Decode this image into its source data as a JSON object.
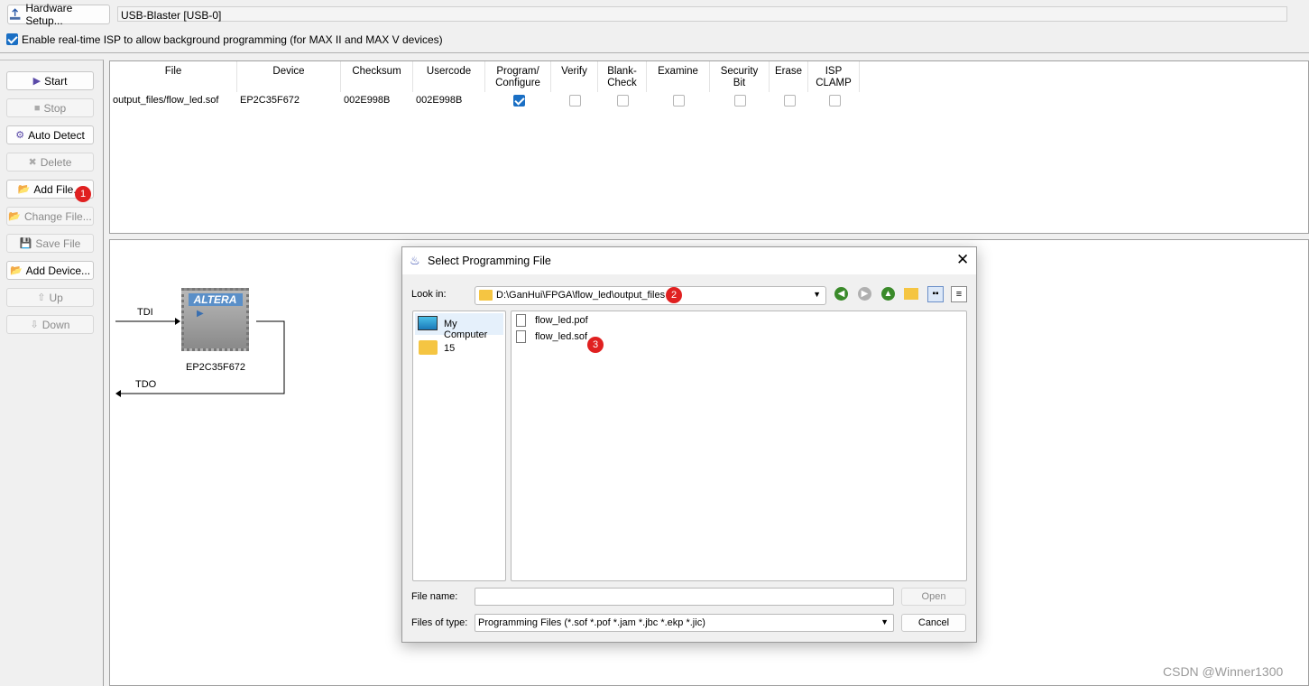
{
  "toolbar": {
    "hardware_setup": "Hardware Setup...",
    "hardware_value": "USB-Blaster [USB-0]",
    "isp_checkbox_label": "Enable real-time ISP to allow background programming (for MAX II and MAX V devices)",
    "isp_checked": true
  },
  "side_buttons": [
    {
      "label": "Start",
      "enabled": true
    },
    {
      "label": "Stop",
      "enabled": false
    },
    {
      "label": "Auto Detect",
      "enabled": true
    },
    {
      "label": "Delete",
      "enabled": false
    },
    {
      "label": "Add File...",
      "enabled": true
    },
    {
      "label": "Change File...",
      "enabled": false
    },
    {
      "label": "Save File",
      "enabled": false
    },
    {
      "label": "Add Device...",
      "enabled": true
    },
    {
      "label": "Up",
      "enabled": false
    },
    {
      "label": "Down",
      "enabled": false
    }
  ],
  "table": {
    "columns": [
      "File",
      "Device",
      "Checksum",
      "Usercode",
      "Program/\nConfigure",
      "Verify",
      "Blank-\nCheck",
      "Examine",
      "Security\nBit",
      "Erase",
      "ISP\nCLAMP"
    ],
    "rows": [
      {
        "file": "output_files/flow_led.sof",
        "device": "EP2C35F672",
        "checksum": "002E998B",
        "usercode": "002E998B",
        "checks": [
          true,
          false,
          false,
          false,
          false,
          false,
          false
        ]
      }
    ]
  },
  "diagram": {
    "tdi": "TDI",
    "tdo": "TDO",
    "chip_label": "EP2C35F672",
    "chip_logo": "ALTERA"
  },
  "dialog": {
    "title": "Select Programming File",
    "look_in_label": "Look in:",
    "look_in_value": "D:\\GanHui\\FPGA\\flow_led\\output_files",
    "places": [
      {
        "label": "My Computer",
        "icon": "monitor-icon"
      },
      {
        "label": "15",
        "icon": "folder-icon"
      }
    ],
    "files": [
      "flow_led.pof",
      "flow_led.sof"
    ],
    "file_name_label": "File name:",
    "file_name_value": "",
    "open": "Open",
    "files_of_type_label": "Files of type:",
    "files_of_type_value": "Programming Files (*.sof *.pof *.jam *.jbc *.ekp *.jic)",
    "cancel": "Cancel"
  },
  "annotations": [
    "1",
    "2",
    "3"
  ],
  "watermark": "CSDN @Winner1300"
}
